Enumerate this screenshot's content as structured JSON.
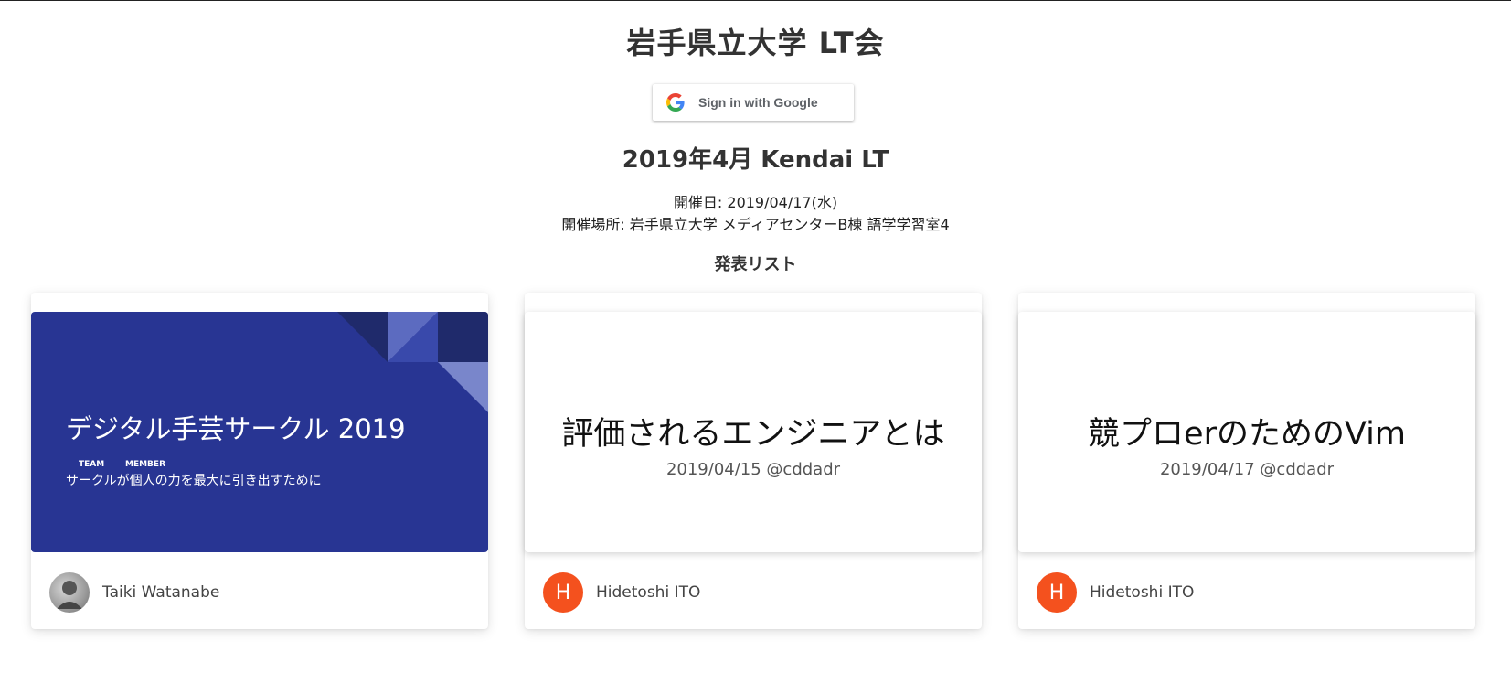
{
  "header": {
    "site_title": "岩手県立大学 LT会",
    "sign_in_label": "Sign in with Google"
  },
  "event": {
    "title": "2019年4月 Kendai LT",
    "date_line": "開催日: 2019/04/17(水)",
    "venue_line": "開催場所: 岩手県立大学 メディアセンターB棟 語学学習室4",
    "talks_heading": "発表リスト"
  },
  "talks": [
    {
      "slide_title": "デジタル手芸サークル 2019",
      "ruby_team": "TEAM",
      "ruby_member": "MEMBER",
      "slide_subtitle": "サークルが個人の力を最大に引き出すために",
      "presenter": "Taiki Watanabe",
      "avatar": "photo"
    },
    {
      "slide_title": "評価されるエンジニアとは",
      "slide_subtitle": "2019/04/15 @cddadr",
      "presenter": "Hidetoshi ITO",
      "avatar_letter": "H"
    },
    {
      "slide_title": "競プロerのためのVim",
      "slide_subtitle": "2019/04/17 @cddadr",
      "presenter": "Hidetoshi ITO",
      "avatar_letter": "H"
    }
  ],
  "colors": {
    "slide_blue": "#283593",
    "avatar_orange": "#f4511e"
  },
  "icons": {
    "sign_in": "google-g-icon"
  }
}
